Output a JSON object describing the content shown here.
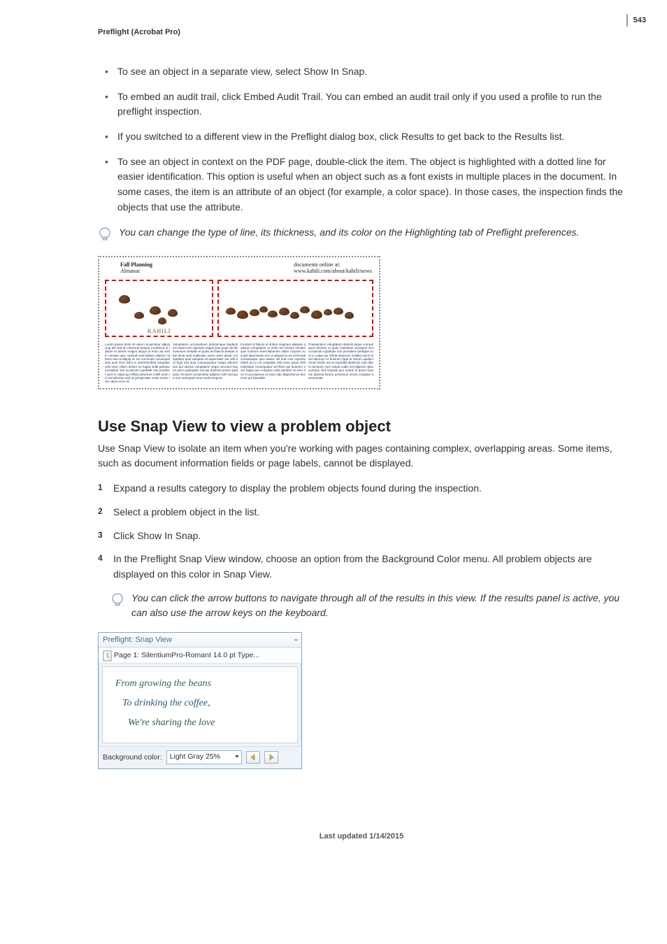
{
  "page_number": "543",
  "header": "Preflight (Acrobat Pro)",
  "bullets": [
    "To see an object in a separate view, select Show In Snap.",
    "To embed an audit trail, click Embed Audit Trail. You can embed an audit trail only if you used a profile to run the preflight inspection.",
    "If you switched to a different view in the Preflight dialog box, click Results to get back to the Results list.",
    "To see an object in context on the PDF page, double-click the item. The object is highlighted with a dotted line for easier identification. This option is useful when an object such as a font exists in multiple places in the document. In some cases, the item is an attribute of an object (for example, a color space). In those cases, the inspection finds the objects that use the attribute."
  ],
  "tip1": "You can change the type of line, its thickness, and its color on the Highlighting tab of Preflight preferences.",
  "figure1": {
    "left_top": "Fall Planning",
    "left_bottom": "Almanac",
    "right_top": "documents online at:",
    "right_bottom": "www.kahili.com/about/kahili/news",
    "brand": "KAHILI"
  },
  "section_title": "Use Snap View to view a problem object",
  "section_intro": "Use Snap View to isolate an item when you're working with pages containing complex, overlapping areas. Some items, such as document information fields or page labels, cannot be displayed.",
  "steps": [
    "Expand a results category to display the problem objects found during the inspection.",
    "Select a problem object in the list.",
    "Click Show In Snap.",
    "In the Preflight Snap View window, choose an option from the Background Color menu. All problem objects are displayed on this color in Snap View."
  ],
  "tip2": "You can click the arrow buttons to navigate through all of the results in this view. If the results panel is active, you can also use the arrow keys on the keyboard.",
  "snap": {
    "title": "Preflight: Snap View",
    "subtitle": "Page 1: SilentiumPro-RomanI 14.0 pt Type...",
    "line1": "From growing the beans",
    "line2": "To drinking the coffee,",
    "line3": "We're sharing the love",
    "bg_label": "Background color:",
    "bg_value": "Light Gray 25%"
  },
  "footer": "Last updated 1/14/2015"
}
